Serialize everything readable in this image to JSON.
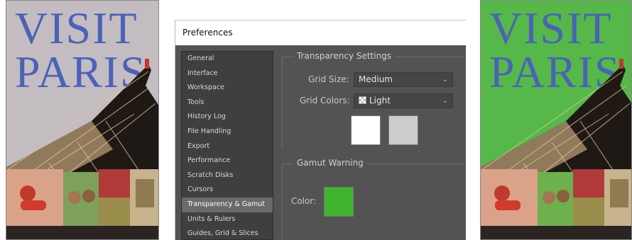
{
  "dialog": {
    "title": "Preferences",
    "nav_items": [
      {
        "label": "General"
      },
      {
        "label": "Interface"
      },
      {
        "label": "Workspace"
      },
      {
        "label": "Tools"
      },
      {
        "label": "History Log"
      },
      {
        "label": "File Handling"
      },
      {
        "label": "Export"
      },
      {
        "label": "Performance"
      },
      {
        "label": "Scratch Disks"
      },
      {
        "label": "Cursors"
      },
      {
        "label": "Transparency & Gamut"
      },
      {
        "label": "Units & Rulers"
      },
      {
        "label": "Guides, Grid & Slices"
      }
    ],
    "selected_nav": "Transparency & Gamut",
    "transparency": {
      "heading": "Transparency Settings",
      "grid_size_label": "Grid Size:",
      "grid_size_value": "Medium",
      "grid_colors_label": "Grid Colors:",
      "grid_colors_value": "Light",
      "swatch_1_color": "#ffffff",
      "swatch_2_color": "#cccccc"
    },
    "gamut": {
      "heading": "Gamut Warning",
      "color_label": "Color:",
      "color_value": "#3fb52e"
    }
  },
  "posters": {
    "left_line1": "VISIT",
    "left_line2": "PARIS",
    "right_line1": "VISIT",
    "right_line2": "PARIS",
    "left_background": "#c3bcc0",
    "right_background": "#55b848"
  },
  "icons": {
    "dropdown": "chevron-down-icon",
    "grid_pattern": "checkerboard-icon"
  }
}
